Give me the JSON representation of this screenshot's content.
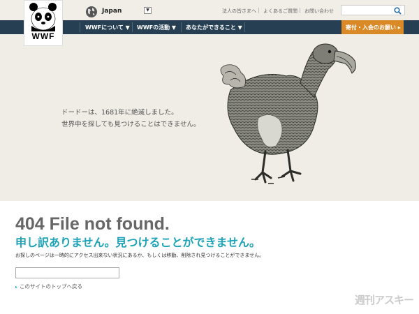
{
  "header": {
    "logo_text": "WWF",
    "country": "Japan",
    "links": [
      "法人の皆さまへ",
      "よくあるご質問",
      "お問い合わせ"
    ],
    "search_placeholder": ""
  },
  "nav": {
    "items": [
      "WWFについて ▼",
      "WWFの活動 ▼",
      "あなたができること ▼"
    ],
    "donate": "寄付・入会のお願い ▸"
  },
  "hero": {
    "line1": "ドードーは、1681年に絶滅しました。",
    "line2": "世界中を探しても見つけることはできません。"
  },
  "error": {
    "title": "404 File not found.",
    "subtitle": "申し訳ありません。見つけることができません。",
    "description": "お探しのページは一時的にアクセス出来ない状況にあるか、もしくは移動、削除され見つけることができません。",
    "back_link": "このサイトのトップへ戻る"
  },
  "watermark": "週刊アスキー",
  "colors": {
    "nav_bg": "#263f52",
    "donate_bg": "#d98a26",
    "accent_teal": "#1da3b7",
    "hero_bg": "#efede6"
  }
}
